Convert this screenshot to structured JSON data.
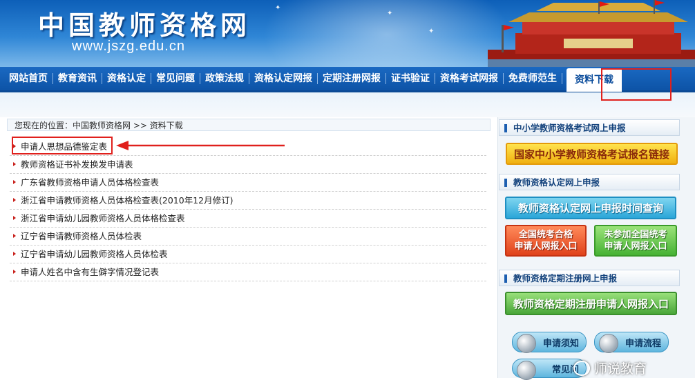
{
  "banner": {
    "site_name": "中国教师资格网",
    "site_url": "www.jszg.edu.cn"
  },
  "nav": {
    "items": [
      "网站首页",
      "教育资讯",
      "资格认定",
      "常见问题",
      "政策法规",
      "资格认定网报",
      "定期注册网报",
      "证书验证",
      "资格考试网报",
      "免费师范生"
    ],
    "active": "资料下载"
  },
  "breadcrumb": {
    "prefix": "您现在的位置：",
    "path": "中国教师资格网 >> 资料下载"
  },
  "downloads": [
    "申请人思想品德鉴定表",
    "教师资格证书补发换发申请表",
    "广东省教师资格申请人员体格检查表",
    "浙江省申请教师资格人员体格检查表(2010年12月修订)",
    "浙江省申请幼儿园教师资格人员体格检查表",
    "辽宁省申请教师资格人员体检表",
    "辽宁省申请幼儿园教师资格人员体检表",
    "申请人姓名中含有生僻字情况登记表"
  ],
  "sidebar": {
    "section1_title": "中小学教师资格考试网上申报",
    "exam_link": "国家中小学教师资格考试报名链接",
    "section2_title": "教师资格认定网上申报",
    "time_query": "教师资格认定网上申报时间查询",
    "passed_line1": "全国统考合格",
    "passed_line2": "申请人网报入口",
    "notpassed_line1": "未参加全国统考",
    "notpassed_line2": "申请人网报入口",
    "section3_title": "教师资格定期注册网上申报",
    "register_entry": "教师资格定期注册申请人网报入口",
    "notice": "申请须知",
    "process": "申请流程",
    "faq": "常见问"
  },
  "watermark": "师说教育",
  "colors": {
    "nav_bg": "#0d53a6",
    "annotation_red": "#e0201c",
    "bullet_red": "#c8201b"
  }
}
